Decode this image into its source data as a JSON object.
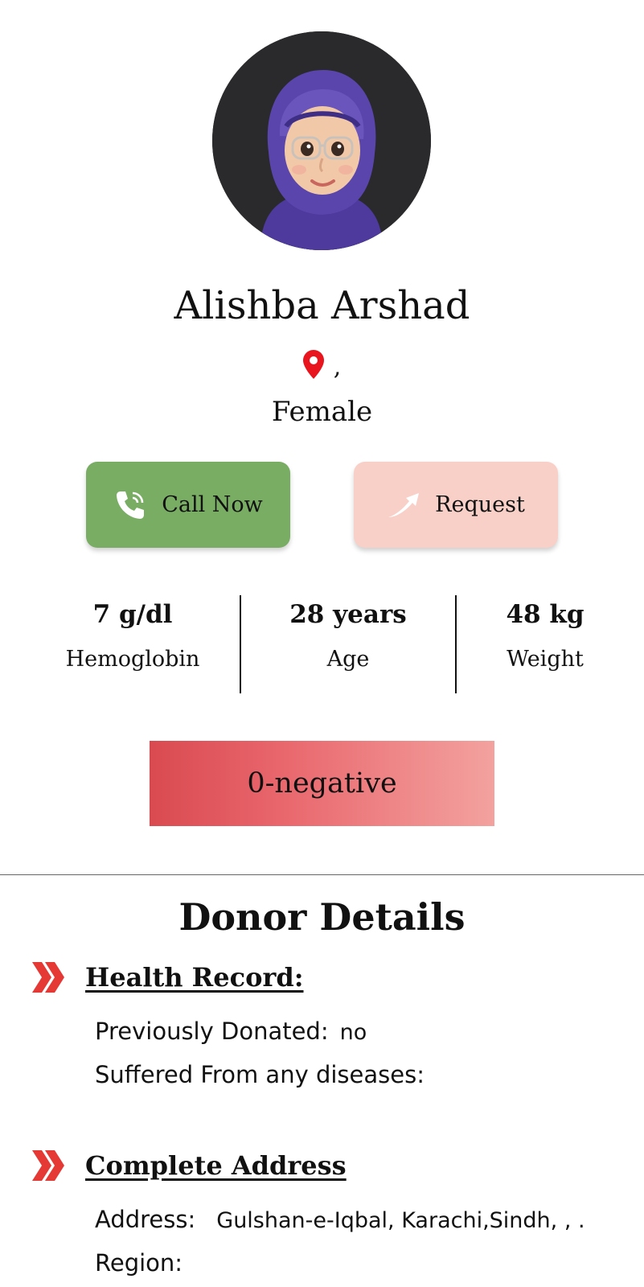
{
  "profile": {
    "name": "Alishba Arshad",
    "location": ",",
    "gender": "Female"
  },
  "actions": {
    "call_label": "Call Now",
    "request_label": "Request"
  },
  "stats": [
    {
      "value": "7 g/dl",
      "label": "Hemoglobin"
    },
    {
      "value": "28 years",
      "label": "Age"
    },
    {
      "value": "48 kg",
      "label": "Weight"
    }
  ],
  "blood_group": "0-negative",
  "details": {
    "title": "Donor Details",
    "health": {
      "heading": "Health Record:",
      "previously_donated_label": "Previously Donated:",
      "previously_donated_value": "no",
      "diseases_label": "Suffered From any diseases:",
      "diseases_value": ""
    },
    "address": {
      "heading": "Complete Address",
      "address_label": "Address:",
      "address_value": "Gulshan-e-Iqbal, Karachi,Sindh, , .",
      "region_label": "Region:",
      "region_value": ""
    }
  },
  "icons": {
    "avatar": "avatar-image",
    "location": "location-pin-icon",
    "call": "phone-icon",
    "request": "arrow-icon",
    "section_marker": "double-chevron-icon"
  },
  "colors": {
    "call_button": "#79ad64",
    "request_button": "#f8d0c8",
    "blood_gradient_start": "#d94a50",
    "blood_gradient_end": "#f3a29f",
    "marker": "#e53935",
    "pin": "#e8141e"
  }
}
